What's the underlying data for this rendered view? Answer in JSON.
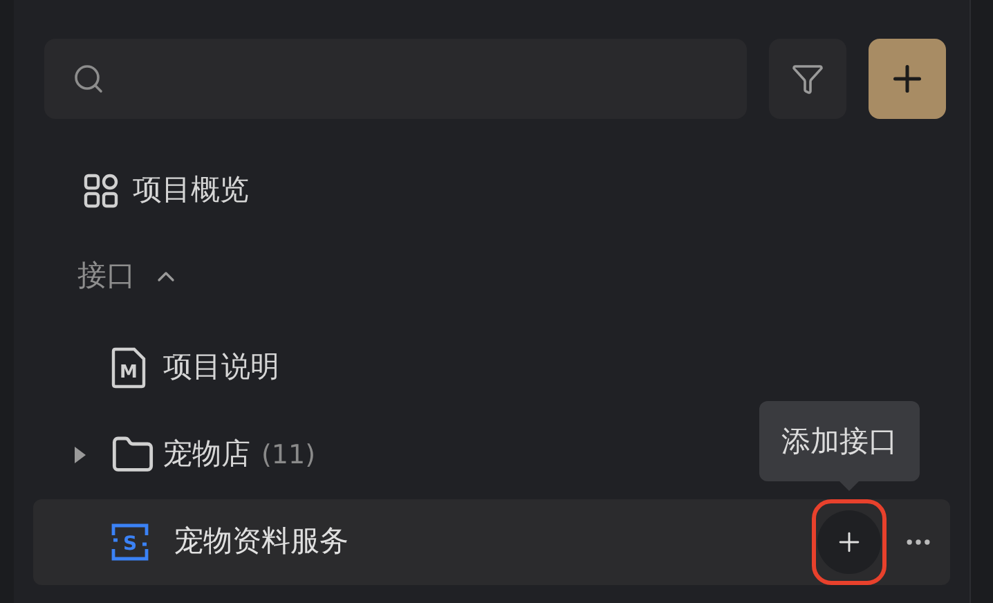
{
  "overview": {
    "label": "项目概览"
  },
  "section": {
    "label": "接口",
    "expanded": true,
    "children": [
      {
        "kind": "doc",
        "label": "项目说明",
        "icon_letter": "M",
        "selected": false
      },
      {
        "kind": "folder",
        "label": "宠物店",
        "count": "(11)",
        "expanded": false,
        "selected": false
      },
      {
        "kind": "service",
        "label": "宠物资料服务",
        "icon_letter": "S",
        "selected": true,
        "add_highlighted": true,
        "tooltip": "添加接口"
      }
    ]
  }
}
